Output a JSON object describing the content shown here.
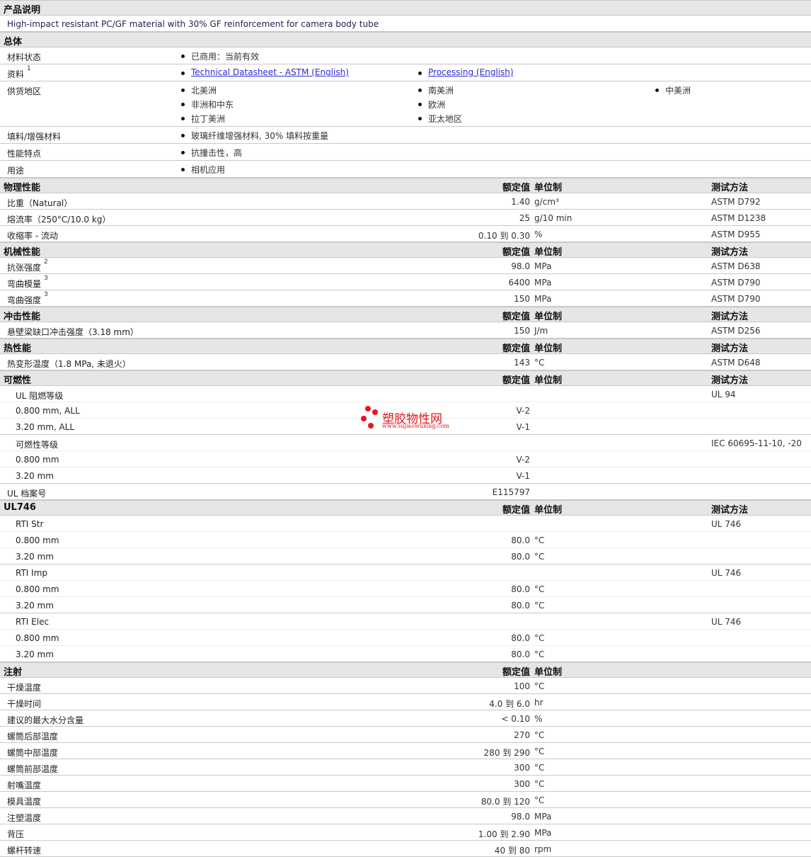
{
  "product_description": {
    "header": "产品说明",
    "text": "High-impact resistant PC/GF material with 30% GF reinforcement for camera body tube"
  },
  "general": {
    "header": "总体",
    "rows": [
      {
        "label": "材料状态",
        "items": [
          [
            "已商用：当前有效"
          ]
        ]
      },
      {
        "label": "资料",
        "sup": "1",
        "links": true,
        "items": [
          [
            "Technical Datasheet - ASTM (English)"
          ],
          [
            "Processing (English)"
          ]
        ]
      },
      {
        "label": "供货地区",
        "items": [
          [
            "北美洲",
            "非洲和中东",
            "拉丁美洲"
          ],
          [
            "南美洲",
            "欧洲",
            "亚太地区"
          ],
          [
            "中美洲"
          ]
        ]
      },
      {
        "label": "填料/增强材料",
        "items": [
          [
            "玻璃纤维增强材料, 30% 填料按重量"
          ]
        ]
      },
      {
        "label": "性能特点",
        "items": [
          [
            "抗撞击性，高"
          ]
        ]
      },
      {
        "label": "用途",
        "items": [
          [
            "相机应用"
          ]
        ]
      }
    ]
  },
  "sections": [
    {
      "title": "物理性能",
      "value_h": "额定值",
      "unit_h": "单位制",
      "method_h": "测试方法",
      "rows": [
        {
          "label": "比重（Natural）",
          "value": "1.40",
          "unit": "g/cm³",
          "method": "ASTM D792"
        },
        {
          "label": "熔流率（250°C/10.0 kg）",
          "value": "25",
          "unit": "g/10 min",
          "method": "ASTM D1238"
        },
        {
          "label": "收缩率 - 流动",
          "value": "0.10 到  0.30",
          "unit": "%",
          "method": "ASTM D955"
        }
      ]
    },
    {
      "title": "机械性能",
      "value_h": "额定值",
      "unit_h": "单位制",
      "method_h": "测试方法",
      "rows": [
        {
          "label": "抗张强度",
          "sup": "2",
          "value": "98.0",
          "unit": "MPa",
          "method": "ASTM D638"
        },
        {
          "label": "弯曲模量",
          "sup": "3",
          "value": "6400",
          "unit": "MPa",
          "method": "ASTM D790"
        },
        {
          "label": "弯曲强度",
          "sup": "3",
          "value": "150",
          "unit": "MPa",
          "method": "ASTM D790"
        }
      ]
    },
    {
      "title": "冲击性能",
      "value_h": "额定值",
      "unit_h": "单位制",
      "method_h": "测试方法",
      "rows": [
        {
          "label": "悬壁梁缺口冲击强度（3.18 mm）",
          "value": "150",
          "unit": "J/m",
          "method": "ASTM D256"
        }
      ]
    },
    {
      "title": "热性能",
      "value_h": "额定值",
      "unit_h": "单位制",
      "method_h": "测试方法",
      "rows": [
        {
          "label": "热变形温度（1.8 MPa, 未退火）",
          "value": "143",
          "unit": "°C",
          "method": "ASTM D648"
        }
      ]
    },
    {
      "title": "可燃性",
      "value_h": "额定值",
      "unit_h": "单位制",
      "method_h": "测试方法",
      "rows": [
        {
          "label": "UL 阻燃等级",
          "method": "UL 94",
          "sub_next": true
        },
        {
          "label": "0.800 mm, ALL",
          "value": "V-2",
          "sub": true
        },
        {
          "label": "3.20 mm, ALL",
          "value": "V-1"
        },
        {
          "label": "可燃性等级",
          "method": "IEC 60695-11-10, -20",
          "sub_next": true
        },
        {
          "label": "0.800 mm",
          "value": "V-2",
          "sub": true
        },
        {
          "label": "3.20 mm",
          "value": "V-1"
        },
        {
          "label": "UL 档案号",
          "value": "E115797"
        }
      ]
    },
    {
      "title": "UL746",
      "value_h": "额定值",
      "unit_h": "单位制",
      "method_h": "测试方法",
      "rows": [
        {
          "label": "RTI Str",
          "method": "UL 746",
          "sub_next": true
        },
        {
          "label": "0.800 mm",
          "value": "80.0",
          "unit": "°C",
          "sub": true
        },
        {
          "label": "3.20 mm",
          "value": "80.0",
          "unit": "°C"
        },
        {
          "label": "RTI Imp",
          "method": "UL 746",
          "sub_next": true
        },
        {
          "label": "0.800 mm",
          "value": "80.0",
          "unit": "°C",
          "sub": true
        },
        {
          "label": "3.20 mm",
          "value": "80.0",
          "unit": "°C"
        },
        {
          "label": "RTI Elec",
          "method": "UL 746",
          "sub_next": true
        },
        {
          "label": "0.800 mm",
          "value": "80.0",
          "unit": "°C",
          "sub": true
        },
        {
          "label": "3.20 mm",
          "value": "80.0",
          "unit": "°C"
        }
      ]
    },
    {
      "title": "注射",
      "value_h": "额定值",
      "unit_h": "单位制",
      "rows": [
        {
          "label": "干燥温度",
          "value": "100",
          "unit": "°C"
        },
        {
          "label": "干燥时间",
          "value": "4.0 到  6.0",
          "unit": "hr"
        },
        {
          "label": "建议的最大水分含量",
          "value": "< 0.10",
          "unit": "%"
        },
        {
          "label": "螺筒后部温度",
          "value": "270",
          "unit": "°C"
        },
        {
          "label": "螺筒中部温度",
          "value": "280 到  290",
          "unit": "°C"
        },
        {
          "label": "螺筒前部温度",
          "value": "300",
          "unit": "°C"
        },
        {
          "label": "射嘴温度",
          "value": "300",
          "unit": "°C"
        },
        {
          "label": "模具温度",
          "value": "80.0 到  120",
          "unit": "°C"
        },
        {
          "label": "注塑温度",
          "value": "98.0",
          "unit": "MPa"
        },
        {
          "label": "背压",
          "value": "1.00 到  2.90",
          "unit": "MPa"
        },
        {
          "label": "螺杆转速",
          "value": "40 到  80",
          "unit": "rpm"
        }
      ]
    }
  ],
  "watermark": {
    "name": "塑胶物性网",
    "url": "www.sujiaowuxing.com"
  }
}
